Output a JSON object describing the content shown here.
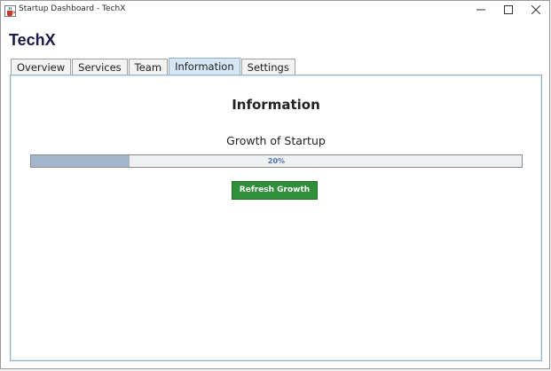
{
  "window": {
    "title": "Startup Dashboard - TechX",
    "icons": {
      "app": "coffee-cup-icon",
      "minimize": "minimize-icon",
      "maximize": "maximize-icon",
      "close": "close-icon"
    }
  },
  "header": {
    "brand": "TechX"
  },
  "tabs": [
    {
      "label": "Overview",
      "active": false
    },
    {
      "label": "Services",
      "active": false
    },
    {
      "label": "Team",
      "active": false
    },
    {
      "label": "Information",
      "active": true
    },
    {
      "label": "Settings",
      "active": false
    }
  ],
  "panel": {
    "title": "Information",
    "growth_label": "Growth of Startup",
    "progress": {
      "value": 20,
      "text": "20%"
    },
    "refresh_label": "Refresh Growth"
  },
  "colors": {
    "brand": "#1b1b4b",
    "active_tab": "#d7e6f5",
    "progress_fill": "#a3b6cb",
    "progress_text": "#4f73ad",
    "button": "#2f8f3a"
  }
}
